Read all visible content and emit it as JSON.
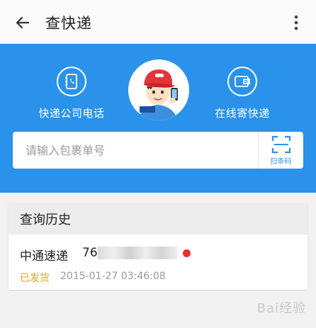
{
  "appbar": {
    "title": "查快递"
  },
  "hero": {
    "left_action": {
      "label": "快递公司电话",
      "icon": "phone-book-icon"
    },
    "right_action": {
      "label": "在线寄快递",
      "icon": "wallet-icon"
    }
  },
  "search": {
    "placeholder": "请输入包裹单号",
    "value": "",
    "scan_label": "扫条码"
  },
  "history": {
    "heading": "查询历史",
    "items": [
      {
        "courier": "中通速递",
        "tracking_visible": "76",
        "status": "已发货",
        "time": "2015-01-27 03:46:08"
      }
    ]
  },
  "watermark": {
    "text": "Bai经验"
  },
  "colors": {
    "primary": "#2a92ea",
    "status_shipped": "#e9a21b",
    "new_dot": "#ef2d2d"
  }
}
